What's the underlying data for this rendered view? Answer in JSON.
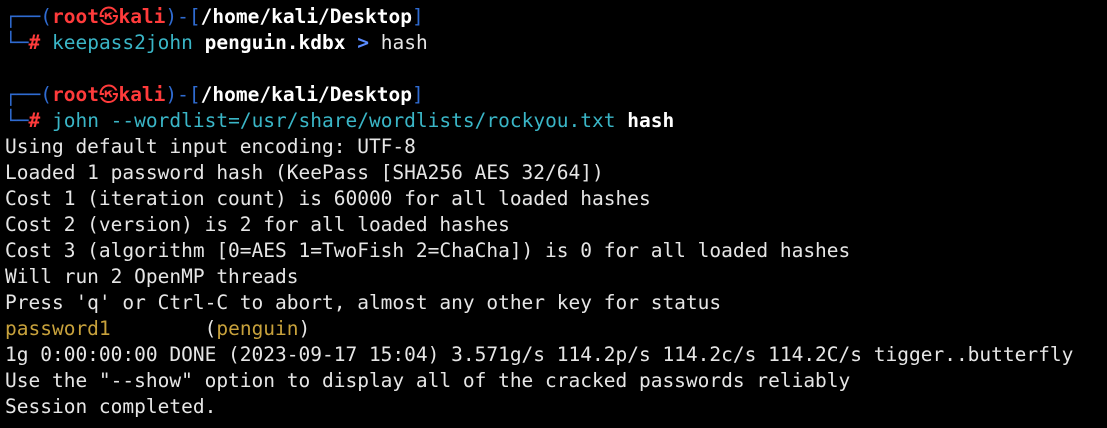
{
  "colors": {
    "background": "#000000",
    "frame": "#2f6bd1",
    "user": "#ff3b3b",
    "command": "#3ab6c7",
    "cracked": "#c8a23c",
    "text": "#e6e6e6"
  },
  "prompt": {
    "frame_top_left": "┌──(",
    "user": "root",
    "separator_icon": "㉿",
    "host": "kali",
    "frame_mid": ")-[",
    "cwd": "/home/kali/Desktop",
    "frame_close": "]",
    "frame_bottom": "└─",
    "symbol": "#"
  },
  "commands": [
    {
      "program": "keepass2john",
      "target": "penguin.kdbx",
      "redirect": ">",
      "rest": "hash"
    },
    {
      "program": "john --wordlist=/usr/share/wordlists/rockyou.txt",
      "target": "hash"
    }
  ],
  "output": [
    "Using default input encoding: UTF-8",
    "Loaded 1 password hash (KeePass [SHA256 AES 32/64])",
    "Cost 1 (iteration count) is 60000 for all loaded hashes",
    "Cost 2 (version) is 2 for all loaded hashes",
    "Cost 3 (algorithm [0=AES 1=TwoFish 2=ChaCha]) is 0 for all loaded hashes",
    "Will run 2 OpenMP threads",
    "Press 'q' or Ctrl-C to abort, almost any other key for status"
  ],
  "cracked": {
    "password": "password1",
    "spacer": "        ",
    "open": "(",
    "name": "penguin",
    "close": ")"
  },
  "final_output": [
    "1g 0:00:00:00 DONE (2023-09-17 15:04) 3.571g/s 114.2p/s 114.2c/s 114.2C/s tigger..butterfly",
    "Use the \"--show\" option to display all of the cracked passwords reliably",
    "Session completed."
  ]
}
